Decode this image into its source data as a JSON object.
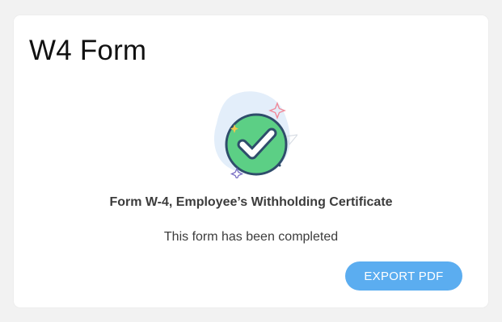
{
  "card": {
    "title": "W4 Form",
    "illustration_icon": "check-circle-icon",
    "form_name": "Form W-4, Employee’s Withholding Certificate",
    "status_text": "This form has been completed",
    "export_label": "EXPORT PDF"
  },
  "colors": {
    "background": "#f2f2f2",
    "card": "#ffffff",
    "check_fill": "#5ccf85",
    "check_outline": "#2f4d6b",
    "blob": "#e3eefa",
    "button": "#5badf0",
    "button_text": "#ffffff",
    "text": "#3c3c3c"
  }
}
